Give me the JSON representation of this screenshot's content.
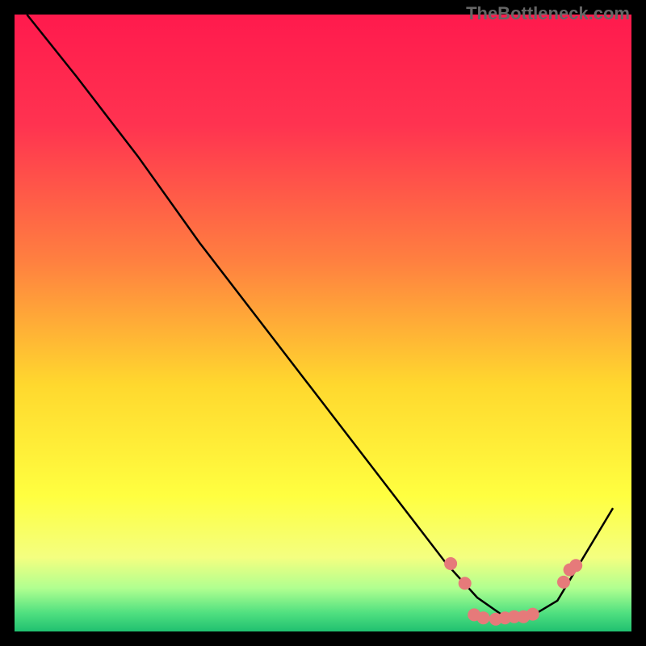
{
  "watermark": "TheBottleneck.com",
  "chart_data": {
    "type": "line",
    "title": "",
    "xlabel": "",
    "ylabel": "",
    "xlim": [
      0,
      1
    ],
    "ylim": [
      0,
      1
    ],
    "series": [
      {
        "name": "curve",
        "x": [
          0.02,
          0.1,
          0.2,
          0.3,
          0.4,
          0.5,
          0.6,
          0.7,
          0.75,
          0.8,
          0.83,
          0.88,
          0.97
        ],
        "y": [
          1.0,
          0.9,
          0.77,
          0.63,
          0.5,
          0.37,
          0.24,
          0.11,
          0.055,
          0.02,
          0.02,
          0.05,
          0.2
        ]
      }
    ],
    "dots": [
      {
        "x": 0.707,
        "y": 0.11
      },
      {
        "x": 0.73,
        "y": 0.078
      },
      {
        "x": 0.745,
        "y": 0.027
      },
      {
        "x": 0.76,
        "y": 0.022
      },
      {
        "x": 0.78,
        "y": 0.02
      },
      {
        "x": 0.795,
        "y": 0.022
      },
      {
        "x": 0.81,
        "y": 0.024
      },
      {
        "x": 0.825,
        "y": 0.024
      },
      {
        "x": 0.84,
        "y": 0.028
      },
      {
        "x": 0.89,
        "y": 0.08
      },
      {
        "x": 0.9,
        "y": 0.1
      },
      {
        "x": 0.91,
        "y": 0.107
      }
    ],
    "gradient_stops": [
      {
        "offset": 0.0,
        "color": "#ff1a4d"
      },
      {
        "offset": 0.18,
        "color": "#ff3350"
      },
      {
        "offset": 0.4,
        "color": "#ff8040"
      },
      {
        "offset": 0.6,
        "color": "#ffd82e"
      },
      {
        "offset": 0.78,
        "color": "#ffff40"
      },
      {
        "offset": 0.88,
        "color": "#f4ff80"
      },
      {
        "offset": 0.93,
        "color": "#b0ff90"
      },
      {
        "offset": 0.97,
        "color": "#50e080"
      },
      {
        "offset": 1.0,
        "color": "#20c070"
      }
    ],
    "dot_color": "#e67a7a",
    "line_color": "#000000"
  }
}
